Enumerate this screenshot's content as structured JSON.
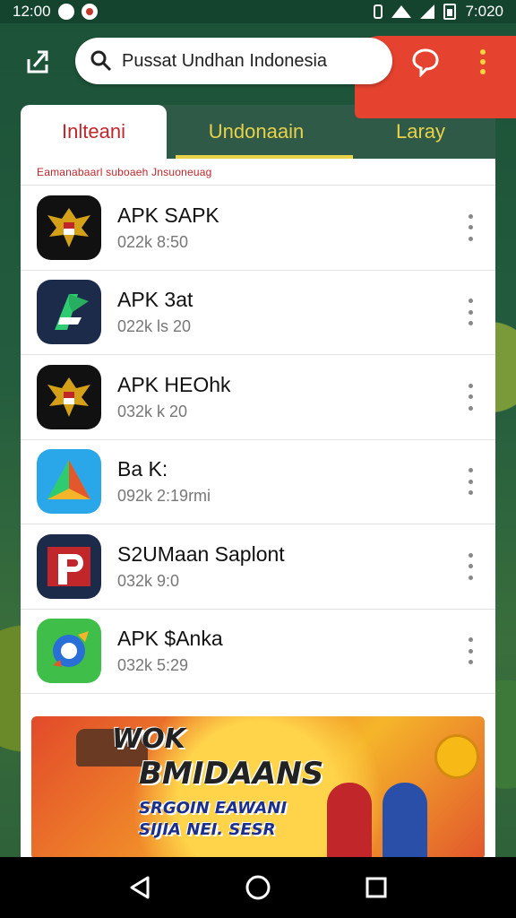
{
  "status_bar": {
    "time": "12:00",
    "right_text": "7:020"
  },
  "top_bar": {
    "search_text": "Pussat Undhan Indonesia",
    "share_icon": "share-icon",
    "chat_icon": "chat-bubble-icon",
    "menu_icon": "more-vert-icon"
  },
  "tabs": [
    {
      "label": "Inlteani"
    },
    {
      "label": "Undonaain"
    },
    {
      "label": "Laray"
    }
  ],
  "section_title": "Eamanabaarl suboaeh Jnsuoneuag",
  "apps": [
    {
      "name": "APK SAPK",
      "meta": "022k 8:50",
      "icon": "garuda-emblem-icon"
    },
    {
      "name": "APK 3at",
      "meta": "022k ls 20",
      "icon": "green-a-logo-icon"
    },
    {
      "name": "APK HEOhk",
      "meta": "032k k 20",
      "icon": "garuda-emblem-icon"
    },
    {
      "name": "Ba K:",
      "meta": "092k 2:19rmi",
      "icon": "colorful-triangle-icon"
    },
    {
      "name": "S2UMaan Saplont",
      "meta": "032k 9:0",
      "icon": "red-p-document-icon"
    },
    {
      "name": "APK $Anka",
      "meta": "032k 5:29",
      "icon": "rocket-badge-icon"
    }
  ],
  "banner": {
    "line1": "WOK",
    "line2": "BMIDAANS",
    "line3": "SRGOIN EAWANI",
    "line4": "SIJIA NEI. SESR"
  },
  "nav": {
    "back_icon": "back-triangle-icon",
    "home_icon": "home-circle-icon",
    "recents_icon": "recents-square-icon"
  },
  "colors": {
    "accent_red": "#e5432f",
    "tab_bar": "#2f5a48",
    "tab_active_text": "#c0262a",
    "tab_text": "#e8d24a"
  }
}
